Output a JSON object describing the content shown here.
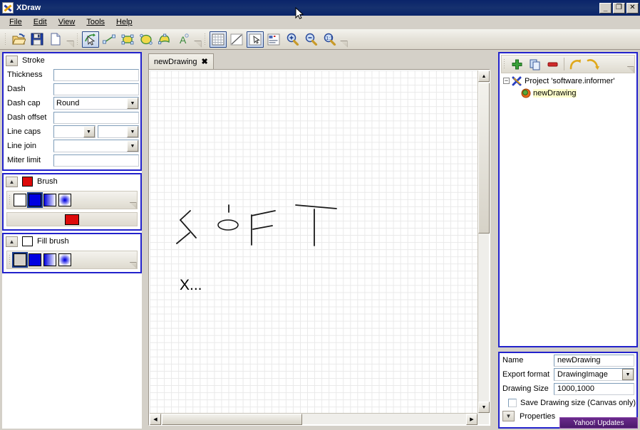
{
  "window": {
    "title": "XDraw",
    "app_icon": "xdraw-logo-icon",
    "minimize_label": "_",
    "maximize_label": "❐",
    "close_label": "✕"
  },
  "menubar": {
    "items": [
      {
        "label": "File",
        "accel": "F"
      },
      {
        "label": "Edit",
        "accel": "E"
      },
      {
        "label": "View",
        "accel": "V"
      },
      {
        "label": "Tools",
        "accel": "T"
      },
      {
        "label": "Help",
        "accel": "H"
      }
    ]
  },
  "toolbar": {
    "groups": [
      {
        "buttons": [
          {
            "name": "open-icon",
            "title": "Open"
          },
          {
            "name": "save-icon",
            "title": "Save"
          },
          {
            "name": "new-document-icon",
            "title": "New"
          }
        ]
      },
      {
        "buttons": [
          {
            "name": "select-tool-icon",
            "title": "Select",
            "active": true
          },
          {
            "name": "line-tool-icon",
            "title": "Line"
          },
          {
            "name": "rectangle-tool-icon",
            "title": "Rectangle"
          },
          {
            "name": "ellipse-tool-icon",
            "title": "Ellipse"
          },
          {
            "name": "polygon-tool-icon",
            "title": "Polygon"
          },
          {
            "name": "text-tool-icon",
            "title": "Text"
          }
        ]
      },
      {
        "buttons": [
          {
            "name": "grid-toggle-icon",
            "title": "Show grid",
            "active": true
          },
          {
            "name": "snap-diagonal-icon",
            "title": "Snap"
          },
          {
            "name": "pointer-select-icon",
            "title": "Selection mode",
            "active": true
          },
          {
            "name": "properties-panel-icon",
            "title": "Properties"
          },
          {
            "name": "zoom-in-icon",
            "title": "Zoom in"
          },
          {
            "name": "zoom-out-icon",
            "title": "Zoom out"
          },
          {
            "name": "zoom-actual-icon",
            "title": "Zoom 1:1"
          }
        ]
      }
    ]
  },
  "stroke_panel": {
    "title": "Stroke",
    "collapse_icon": "chevron-up-icon",
    "rows": [
      {
        "label": "Thickness",
        "value": "",
        "type": "text"
      },
      {
        "label": "Dash",
        "value": "",
        "type": "text"
      },
      {
        "label": "Dash cap",
        "value": "Round",
        "type": "combo"
      },
      {
        "label": "Dash offset",
        "value": "",
        "type": "text"
      },
      {
        "label": "Line caps",
        "value": "",
        "value2": "",
        "type": "combo-pair"
      },
      {
        "label": "Line join",
        "value": "",
        "type": "combo"
      },
      {
        "label": "Miter limit",
        "value": "",
        "type": "text"
      }
    ]
  },
  "brush_panel": {
    "title": "Brush",
    "collapse_icon": "chevron-up-icon",
    "swatch_color": "#dd0a0a",
    "fills": [
      {
        "name": "brush-none",
        "style": "none",
        "selected": false
      },
      {
        "name": "brush-solid",
        "style": "solid",
        "selected": true
      },
      {
        "name": "brush-linear-gradient",
        "style": "linear",
        "selected": false
      },
      {
        "name": "brush-radial-gradient",
        "style": "radial",
        "selected": false
      }
    ],
    "current_color": "#dd0a0a"
  },
  "fill_brush_panel": {
    "title": "Fill brush",
    "collapse_icon": "chevron-up-icon",
    "swatch_color": "#ffffff",
    "fills": [
      {
        "name": "fillbrush-none",
        "style": "gray",
        "selected": true
      },
      {
        "name": "fillbrush-solid",
        "style": "solid",
        "selected": false
      },
      {
        "name": "fillbrush-linear-gradient",
        "style": "linear",
        "selected": false
      },
      {
        "name": "fillbrush-radial-gradient",
        "style": "radial",
        "selected": false
      }
    ]
  },
  "tabs": [
    {
      "label": "newDrawing",
      "close_icon": "close-icon",
      "active": true
    }
  ],
  "canvas": {
    "grid_visible": true,
    "grid_size": 10,
    "sketch_text": "SOFT",
    "annotation": "X...",
    "scroll_left_arrow": "◀",
    "scroll_right_arrow": "▶",
    "scroll_up_arrow": "▲",
    "scroll_down_arrow": "▼"
  },
  "tree_panel": {
    "toolbar": [
      {
        "name": "add-item-icon",
        "title": "Add"
      },
      {
        "name": "copy-item-icon",
        "title": "Copy"
      },
      {
        "name": "delete-item-icon",
        "title": "Delete"
      },
      {
        "name": "undo-icon",
        "title": "Undo"
      },
      {
        "name": "redo-icon",
        "title": "Redo"
      }
    ],
    "root": {
      "label": "Project 'software.informer'",
      "toggle": "−",
      "icon": "xdraw-project-icon"
    },
    "children": [
      {
        "label": "newDrawing",
        "icon": "drawing-item-icon",
        "selected": true
      }
    ]
  },
  "properties_panel": {
    "rows": [
      {
        "label": "Name",
        "value": "newDrawing",
        "type": "text"
      },
      {
        "label": "Export format",
        "value": "DrawingImage",
        "type": "combo"
      },
      {
        "label": "Drawing Size",
        "value": "1000,1000",
        "type": "text"
      }
    ],
    "checkbox": {
      "label": "Save Drawing size (Canvas only)",
      "checked": false
    },
    "footer": {
      "label": "Properties",
      "collapse_icon": "chevron-down-icon"
    }
  },
  "notification": {
    "label": "Yahoo! Updates"
  }
}
